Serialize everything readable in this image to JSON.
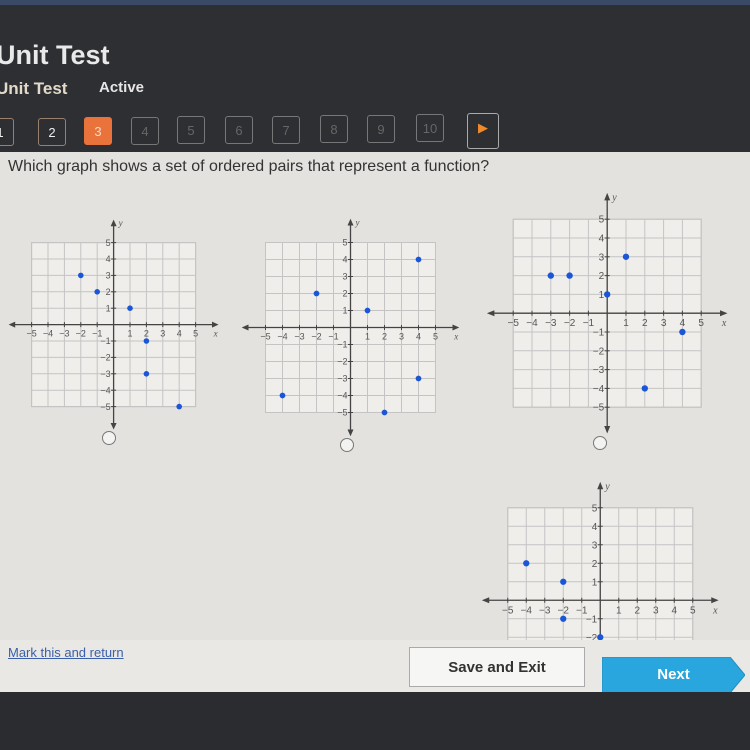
{
  "header": {
    "title": "Unit Test",
    "subtitle": "Unit Test",
    "status": "Active"
  },
  "question_nav": {
    "items": [
      "1",
      "2",
      "3",
      "4",
      "5",
      "6",
      "7",
      "8",
      "9",
      "10"
    ],
    "current": "3",
    "answered": [
      "1",
      "2"
    ],
    "next_icon": "play-arrow-icon"
  },
  "question": {
    "text": "Which graph shows a set of ordered pairs that represent a function?"
  },
  "colors": {
    "accent": "#e9733a",
    "point": "#1a56d6",
    "next_button": "#2aa6de"
  },
  "chart_data": [
    {
      "type": "scatter",
      "xlabel": "x",
      "ylabel": "y",
      "xlim": [
        -5,
        5
      ],
      "ylim": [
        -5,
        5
      ],
      "ticks": [
        -5,
        -4,
        -3,
        -2,
        -1,
        1,
        2,
        3,
        4,
        5
      ],
      "grid": true,
      "points": [
        [
          -2,
          3
        ],
        [
          -1,
          2
        ],
        [
          1,
          1
        ],
        [
          2,
          -1
        ],
        [
          2,
          -3
        ],
        [
          4,
          -5
        ]
      ]
    },
    {
      "type": "scatter",
      "xlabel": "x",
      "ylabel": "y",
      "xlim": [
        -5,
        5
      ],
      "ylim": [
        -5,
        5
      ],
      "ticks": [
        -5,
        -4,
        -3,
        -2,
        -1,
        1,
        2,
        3,
        4,
        5
      ],
      "grid": true,
      "points": [
        [
          -4,
          -4
        ],
        [
          -2,
          2
        ],
        [
          1,
          1
        ],
        [
          2,
          -5
        ],
        [
          4,
          4
        ],
        [
          4,
          -3
        ]
      ]
    },
    {
      "type": "scatter",
      "xlabel": "x",
      "ylabel": "y",
      "xlim": [
        -5,
        5
      ],
      "ylim": [
        -5,
        5
      ],
      "ticks": [
        -5,
        -4,
        -3,
        -2,
        -1,
        1,
        2,
        3,
        4,
        5
      ],
      "grid": true,
      "points": [
        [
          -3,
          2
        ],
        [
          -2,
          2
        ],
        [
          0,
          1
        ],
        [
          1,
          3
        ],
        [
          2,
          -4
        ],
        [
          4,
          -1
        ]
      ]
    },
    {
      "type": "scatter",
      "xlabel": "x",
      "ylabel": "y",
      "xlim": [
        -5,
        5
      ],
      "ylim": [
        -5,
        5
      ],
      "ticks": [
        -5,
        -4,
        -3,
        -2,
        -1,
        1,
        2,
        3,
        4,
        5
      ],
      "grid": true,
      "points": [
        [
          -4,
          2
        ],
        [
          -2,
          1
        ],
        [
          -2,
          -1
        ],
        [
          0,
          -2
        ]
      ]
    }
  ],
  "footer": {
    "mark_link": "Mark this and return",
    "save_label": "Save and Exit",
    "next_label": "Next"
  }
}
